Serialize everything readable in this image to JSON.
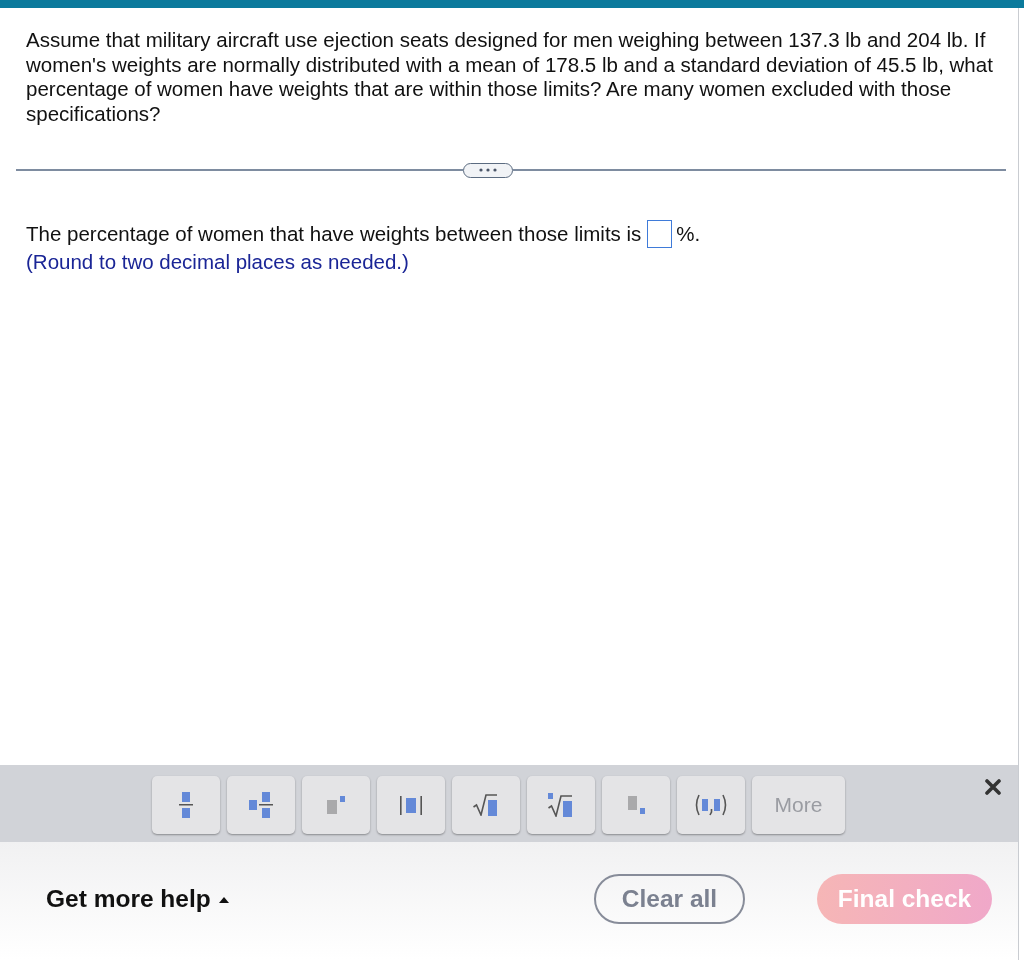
{
  "question": {
    "text": "Assume that military aircraft use ejection seats designed for men weighing between 137.3 lb and 204 lb. If women's weights are normally distributed with a mean of 178.5 lb and a standard deviation of 45.5 lb, what percentage of women have weights that are within those limits? Are many women excluded with those specifications?"
  },
  "answer": {
    "prompt": "The percentage of women that have weights between those limits is",
    "unit": "%.",
    "hint": "(Round to two decimal places as needed.)"
  },
  "math_toolbar": {
    "buttons": [
      {
        "kind": "fraction"
      },
      {
        "kind": "mixed_number"
      },
      {
        "kind": "exponent"
      },
      {
        "kind": "absolute_value"
      },
      {
        "kind": "square_root"
      },
      {
        "kind": "nth_root"
      },
      {
        "kind": "subscript"
      },
      {
        "kind": "ordered_pair"
      }
    ],
    "more": {
      "label": "More",
      "disabled": true
    }
  },
  "footer": {
    "help": {
      "label": "Get more help"
    },
    "clear_button": {
      "label": "Clear all"
    },
    "check_button": {
      "label": "Final check",
      "disabled": true
    }
  }
}
